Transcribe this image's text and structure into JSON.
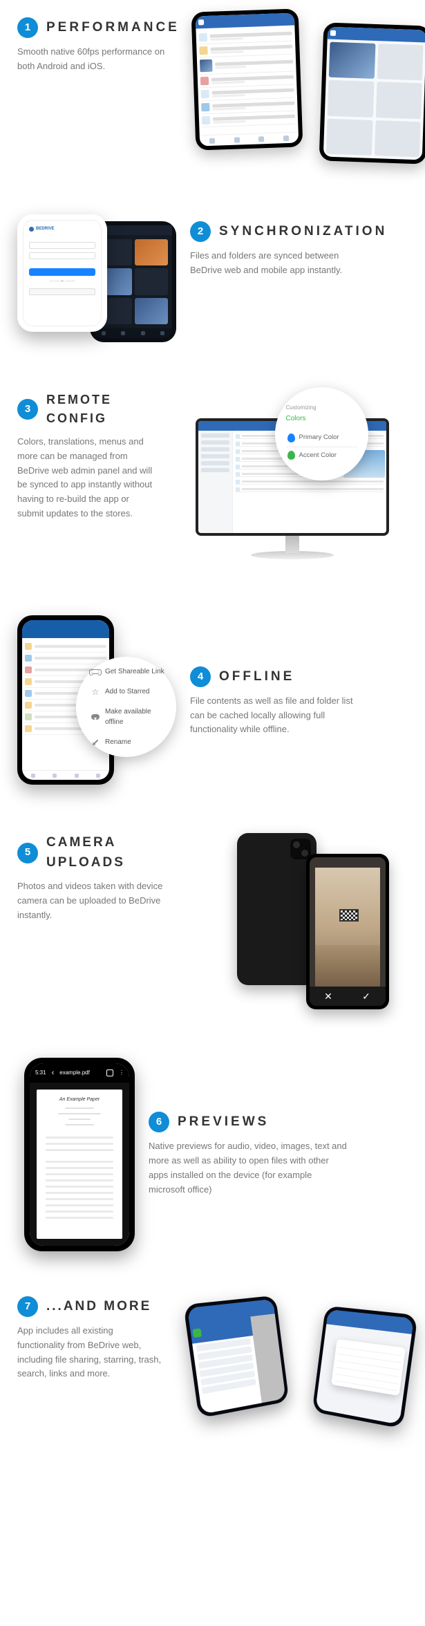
{
  "features": [
    {
      "num": "1",
      "title": "PERFORMANCE",
      "desc": "Smooth native 60fps performance on both Android and iOS."
    },
    {
      "num": "2",
      "title": "SYNCHRONIZATION",
      "desc": "Files and folders are synced between BeDrive web and mobile app instantly."
    },
    {
      "num": "3",
      "title": "REMOTE CONFIG",
      "desc": "Colors, translations, menus and more can be managed from BeDrive web admin panel and will be synced to app instantly without having to re-build the app or submit updates to the stores."
    },
    {
      "num": "4",
      "title": "OFFLINE",
      "desc": "File contents as well as file and folder list can be cached locally allowing full functionality while offline."
    },
    {
      "num": "5",
      "title": "CAMERA UPLOADS",
      "desc": "Photos and videos taken with device camera can be uploaded to BeDrive instantly."
    },
    {
      "num": "6",
      "title": "PREVIEWS",
      "desc": "Native previews for audio, video, images, text and more as well as ability to open files with other apps installed on the device (for example microsoft office)"
    },
    {
      "num": "7",
      "title": "...AND MORE",
      "desc": "App includes all existing functionality from BeDrive web, including file sharing, starring, trash, search, links and more."
    }
  ],
  "s2": {
    "brand": "BEDRIVE"
  },
  "zoom3": {
    "customizing": "Customizing",
    "colors": "Colors",
    "primary": "Primary Color",
    "accent": "Accent Color"
  },
  "zoom4": {
    "share": "Get Shareable Link",
    "star": "Add to Starred",
    "offline": "Make available offline",
    "rename": "Rename"
  },
  "s6": {
    "time": "5:31",
    "file": "example.pdf",
    "doctitle": "An Example Paper"
  }
}
